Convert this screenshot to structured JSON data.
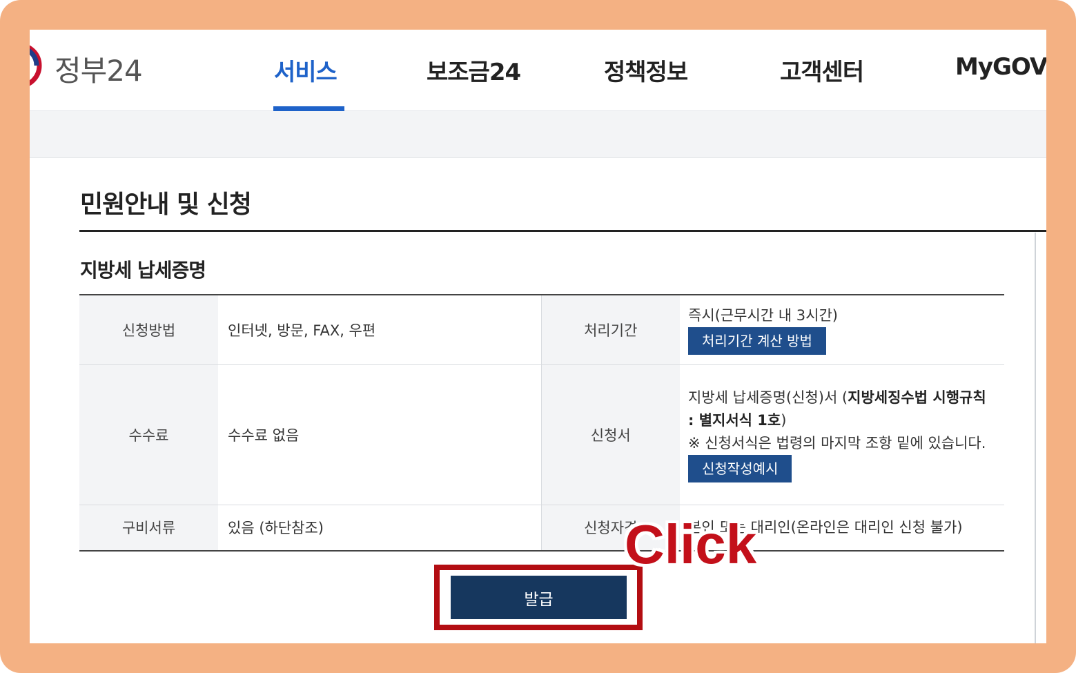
{
  "header": {
    "logo_text": "정부24",
    "nav": [
      "서비스",
      "보조금24",
      "정책정보",
      "고객센터",
      "MyGOV"
    ],
    "active_index": 0
  },
  "page": {
    "title": "민원안내 및 신청",
    "section_title": "지방세 납세증명"
  },
  "table": {
    "row1": {
      "label1": "신청방법",
      "value1": "인터넷, 방문, FAX, 우편",
      "label2": "처리기간",
      "value2": "즉시(근무시간 내 3시간)",
      "button": "처리기간 계산 방법"
    },
    "row2": {
      "label1": "수수료",
      "value1": "수수료 없음",
      "label2": "신청서",
      "value2_pre": "지방세 납세증명(신청)서 (",
      "value2_bold": "지방세징수법 시행규칙 : 별지서식 1호",
      "value2_post": ")",
      "note": "※ 신청서식은 법령의 마지막 조항 밑에 있습니다.",
      "button": "신청작성예시"
    },
    "row3": {
      "label1": "구비서류",
      "value1": "있음 (하단참조)",
      "label2": "신청자격",
      "value2": "본인 또는 대리인(온라인은 대리인 신청 불가)"
    }
  },
  "actions": {
    "issue_label": "발급"
  },
  "annotation": {
    "click_text": "Click",
    "highlight_color": "#b30d12",
    "text_color": "#c3101a",
    "frame_color": "#f4b183"
  },
  "colors": {
    "accent": "#1e62c9",
    "button_blue": "#1f4e8c",
    "issue_navy": "#16375e"
  }
}
